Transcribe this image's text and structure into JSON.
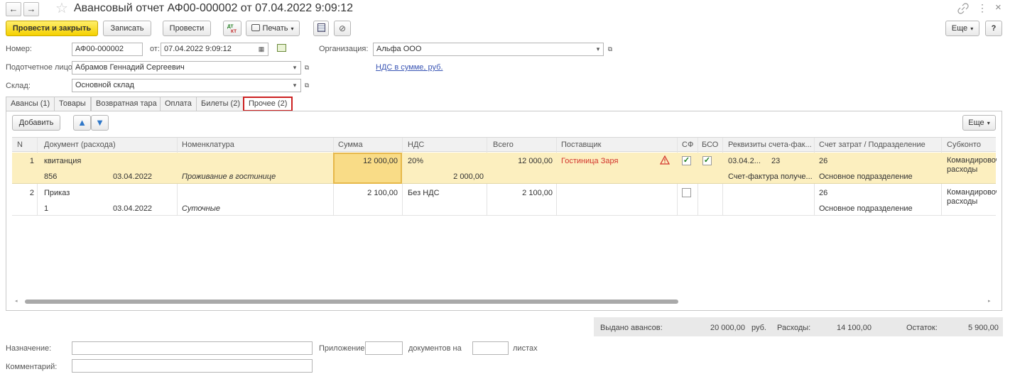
{
  "window": {
    "title": "Авансовый отчет АФ00-000002 от 07.04.2022 9:09:12",
    "back_icon": "←",
    "forward_icon": "→",
    "star_icon": "☆",
    "link_icon": "🔗",
    "menu_icon": "⋮",
    "close_icon": "×"
  },
  "toolbar": {
    "post_close": "Провести и закрыть",
    "save": "Записать",
    "post": "Провести",
    "dtkt": "Дт Кт",
    "print": "Печать",
    "more": "Еще",
    "help": "?"
  },
  "header": {
    "number_label": "Номер:",
    "number_value": "АФ00-000002",
    "date_label": "от:",
    "date_value": "07.04.2022  9:09:12",
    "org_label": "Организация:",
    "org_value": "Альфа ООО",
    "person_label": "Подотчетное лицо:",
    "person_value": "Абрамов Геннадий Сергеевич",
    "vat_link": "НДС в сумме, руб.",
    "warehouse_label": "Склад:",
    "warehouse_value": "Основной склад"
  },
  "tabs": [
    {
      "label": "Авансы (1)"
    },
    {
      "label": "Товары"
    },
    {
      "label": "Возвратная тара"
    },
    {
      "label": "Оплата"
    },
    {
      "label": "Билеты (2)"
    },
    {
      "label": "Прочее (2)"
    }
  ],
  "table_toolbar": {
    "add": "Добавить",
    "up_icon": "🡅",
    "down_icon": "🡇",
    "more": "Еще"
  },
  "table": {
    "columns": [
      "N",
      "Документ (расхода)",
      "Номенклатура",
      "Сумма",
      "НДС",
      "Всего",
      "Поставщик",
      "СФ",
      "БСО",
      "Реквизиты счета-фак...",
      "Счет затрат / Подразделение",
      "Субконто"
    ],
    "rows": [
      {
        "n": "1",
        "doc": "квитанция",
        "doc_num": "856",
        "doc_date": "03.04.2022",
        "nomenclature": "Проживание в гостинице",
        "sum": "12 000,00",
        "vat_rate": "20%",
        "vat_sum": "2 000,00",
        "total": "12 000,00",
        "supplier": "Гостиница Заря",
        "sf": "✓",
        "bso": "✓",
        "invoice_date": "03.04.2...",
        "invoice_num": "23",
        "invoice_status": "Счет-фактура получе...",
        "account": "26",
        "division": "Основное подразделение",
        "subconto": "Командировоч расходы"
      },
      {
        "n": "2",
        "doc": "Приказ",
        "doc_num": "1",
        "doc_date": "03.04.2022",
        "nomenclature": "Суточные",
        "sum": "2 100,00",
        "vat_rate": "Без НДС",
        "total": "2 100,00",
        "account": "26",
        "division": "Основное подразделение",
        "subconto": "Командировоч расходы"
      }
    ]
  },
  "totals": {
    "issued_label": "Выдано авансов:",
    "issued_value": "20 000,00",
    "currency": "руб.",
    "expenses_label": "Расходы:",
    "expenses_value": "14 100,00",
    "balance_label": "Остаток:",
    "balance_value": "5 900,00"
  },
  "footer": {
    "purpose_label": "Назначение:",
    "attachment_label": "Приложение:",
    "docs_on": "документов на",
    "sheets": "листах",
    "comment_label": "Комментарий:"
  },
  "colors": {
    "accent_yellow": "#f5d100",
    "selected_row": "#fcefbf",
    "selected_cell": "#f9dc87",
    "tab_highlight": "#cc2020",
    "supplier_red": "#d2342c",
    "link_blue": "#3a55b4"
  }
}
